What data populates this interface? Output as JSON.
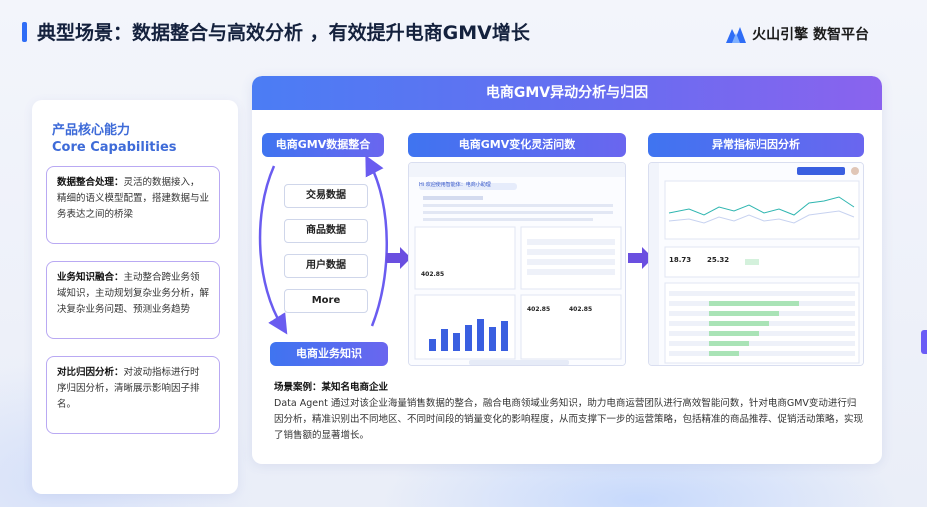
{
  "slide": {
    "title": "典型场景：数据整合与高效分析 ，有效提升电商GMV增长",
    "logo_text": "火山引擎 数智平台"
  },
  "capabilities": {
    "title_cn": "产品核心能力",
    "title_en": "Core Capabilities",
    "cards": [
      {
        "label": "数据整合处理：",
        "text": "灵活的数据接入，精细的语义模型配置，搭建数据与业务表达之间的桥梁"
      },
      {
        "label": "业务知识融合：",
        "text": "主动整合跨业务领域知识，主动规划复杂业务分析，解决复杂业务问题、预测业务趋势"
      },
      {
        "label": "对比归因分析：",
        "text": "对波动指标进行时序归因分析，清晰展示影响因子排名。"
      }
    ]
  },
  "main": {
    "header": "电商GMV异动分析与归因",
    "integration_label": "电商GMV数据整合",
    "data_items": [
      "交易数据",
      "商品数据",
      "用户数据",
      "More"
    ],
    "knowledge_label": "电商业务知识",
    "qa_label": "电商GMV变化灵活问数",
    "attribution_label": "异常指标归因分析",
    "case_title": "场景案例：某知名电商企业",
    "case_text": "Data Agent 通过对该企业海量销售数据的整合，融合电商领域业务知识，助力电商运营团队进行高效智能问数，针对电商GMV变动进行归因分析，精准识别出不同地区、不同时间段的销量变化的影响程度，从而支撑下一步的运营策略，包括精准的商品推荐、促销活动策略，实现了销售额的显著增长。"
  },
  "mock_qa": {
    "greeting": "Hi 欢迎使用智能体：电商小助理",
    "kpi_a": "402.85",
    "kpi_b": "402.85",
    "kpi_c": "402.85"
  },
  "mock_attr": {
    "kpi_a": "18.73",
    "kpi_b": "25.32"
  },
  "colors": {
    "accent_blue": "#3f74f0",
    "accent_purple": "#8a63ee",
    "card_border": "#b9a9f3"
  }
}
